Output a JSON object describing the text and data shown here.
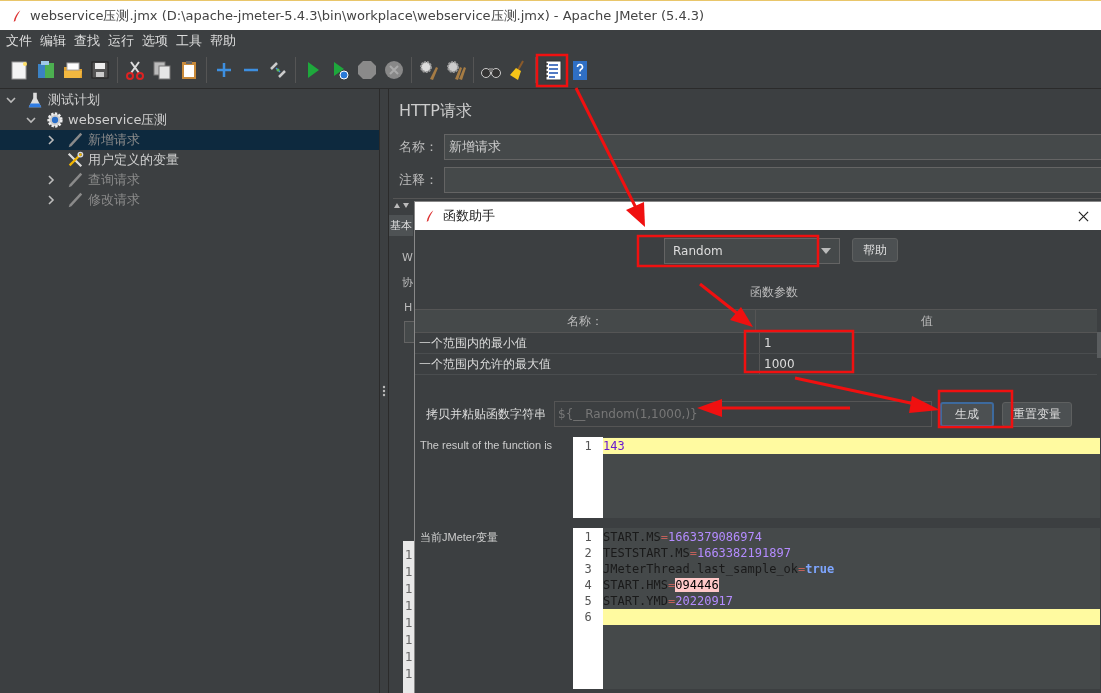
{
  "window": {
    "title": "webservice压测.jmx (D:\\apache-jmeter-5.4.3\\bin\\workplace\\webservice压测.jmx) - Apache JMeter (5.4.3)"
  },
  "menu": [
    "文件",
    "编辑",
    "查找",
    "运行",
    "选项",
    "工具",
    "帮助"
  ],
  "tree": [
    {
      "label": "测试计划",
      "kind": "plan",
      "expanded": true,
      "selected": false,
      "enabled": true,
      "children": [
        {
          "label": "webservice压测",
          "kind": "thread-group",
          "expanded": true,
          "selected": false,
          "enabled": true,
          "children": [
            {
              "label": "新增请求",
              "kind": "sampler",
              "expanded": false,
              "selected": true,
              "enabled": false
            },
            {
              "label": "用户定义的变量",
              "kind": "config",
              "selected": false,
              "enabled": true
            },
            {
              "label": "查询请求",
              "kind": "sampler",
              "expanded": false,
              "selected": false,
              "enabled": false
            },
            {
              "label": "修改请求",
              "kind": "sampler",
              "expanded": false,
              "selected": false,
              "enabled": false
            }
          ]
        }
      ]
    }
  ],
  "panel": {
    "title": "HTTP请求",
    "fields": [
      {
        "label": "名称：",
        "value": "新增请求"
      },
      {
        "label": "注释："
      }
    ]
  },
  "under_dialog": {
    "tab": "基本",
    "labels": [
      "W",
      "协",
      "H"
    ],
    "line_numbers": [
      "1",
      "1",
      "1",
      "1",
      "1",
      "1",
      "1",
      "1"
    ]
  },
  "dialog": {
    "title": "函数助手",
    "function": "Random",
    "help_button": "帮助",
    "params_title": "函数参数",
    "columns": [
      "名称：",
      "值"
    ],
    "rows": [
      {
        "name": "一个范围内的最小值",
        "value": "1"
      },
      {
        "name": "一个范围内允许的最大值",
        "value": "1000"
      }
    ],
    "copy_label": "拷贝并粘贴函数字符串",
    "copy_value": "${__Random(1,1000,)}",
    "buttons": [
      {
        "label": "生成",
        "focused": true
      },
      {
        "label": "重置变量",
        "focused": false
      }
    ],
    "result_label": "The result of the function is",
    "result_lines": [
      {
        "number": "1",
        "value": "143",
        "kind": "number",
        "current": true
      }
    ],
    "vars_label": "当前JMeter变量",
    "var_lines": [
      {
        "number": "1",
        "key": "START.MS",
        "sep": "=",
        "value": "1663379086974",
        "kind": "number",
        "current": false
      },
      {
        "number": "2",
        "key": "TESTSTART.MS",
        "sep": "=",
        "value": "1663382191897",
        "kind": "number",
        "current": false
      },
      {
        "number": "3",
        "key": "JMeterThread.last_sample_ok",
        "sep": "=",
        "value": "true",
        "kind": "keyword",
        "current": false
      },
      {
        "number": "4",
        "key": "START.HMS",
        "sep": "=",
        "value": "094446",
        "kind": "marked",
        "current": false
      },
      {
        "number": "5",
        "key": "START.YMD",
        "sep": "=",
        "value": "20220917",
        "kind": "number",
        "current": false
      },
      {
        "number": "6",
        "current": true
      }
    ]
  }
}
